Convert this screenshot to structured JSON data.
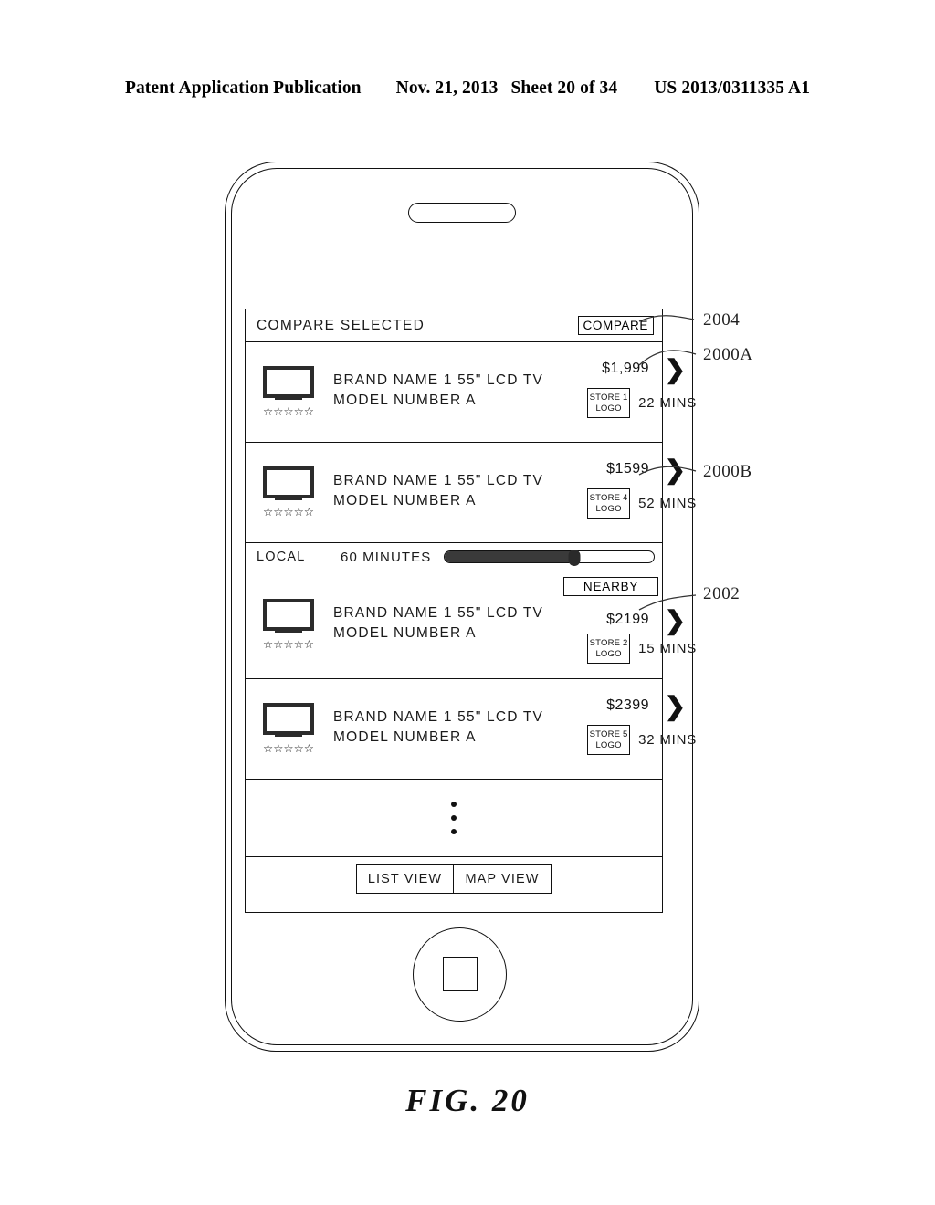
{
  "patent_header": {
    "publication": "Patent Application Publication",
    "date": "Nov. 21, 2013",
    "sheet": "Sheet 20 of 34",
    "number": "US 2013/0311335 A1"
  },
  "figure": {
    "caption": "FIG. 20"
  },
  "device": {
    "speaker_icon": "speaker-slot",
    "home_button_icon": "home-button"
  },
  "screen": {
    "header": {
      "title": "COMPARE SELECTED",
      "compare_button": "COMPARE"
    },
    "products": [
      {
        "name": "BRAND NAME 1 55\" LCD TV",
        "model": "MODEL NUMBER A",
        "stars": "☆☆☆☆☆",
        "price": "$1,999",
        "store_line1": "STORE 1",
        "store_line2": "LOGO",
        "time": "22 MINS",
        "chevron": "❯",
        "badge": ""
      },
      {
        "name": "BRAND NAME 1 55\" LCD TV",
        "model": "MODEL NUMBER A",
        "stars": "☆☆☆☆☆",
        "price": "$1599",
        "store_line1": "STORE 4",
        "store_line2": "LOGO",
        "time": "52 MINS",
        "chevron": "❯",
        "badge": ""
      },
      {
        "name": "BRAND NAME 1 55\" LCD TV",
        "model": "MODEL NUMBER A",
        "stars": "☆☆☆☆☆",
        "price": "$2199",
        "store_line1": "STORE 2",
        "store_line2": "LOGO",
        "time": "15 MINS",
        "chevron": "❯",
        "badge": "NEARBY"
      },
      {
        "name": "BRAND NAME 1 55\" LCD TV",
        "model": "MODEL NUMBER A",
        "stars": "☆☆☆☆☆",
        "price": "$2399",
        "store_line1": "STORE 5",
        "store_line2": "LOGO",
        "time": "32 MINS",
        "chevron": "❯",
        "badge": ""
      }
    ],
    "slider": {
      "left_label": "LOCAL",
      "value_label": "60 MINUTES",
      "fill_percent": 62
    },
    "more_indicator": "vertical-ellipsis",
    "footer": {
      "list_view": "LIST VIEW",
      "map_view": "MAP VIEW"
    }
  },
  "reference_numerals": {
    "compare_button": "2004",
    "product_row_a": "2000A",
    "product_row_b": "2000B",
    "slider_control": "2002"
  },
  "colors": {
    "line": "#111111",
    "fill_dark": "#3a3a3a",
    "background": "#ffffff"
  }
}
